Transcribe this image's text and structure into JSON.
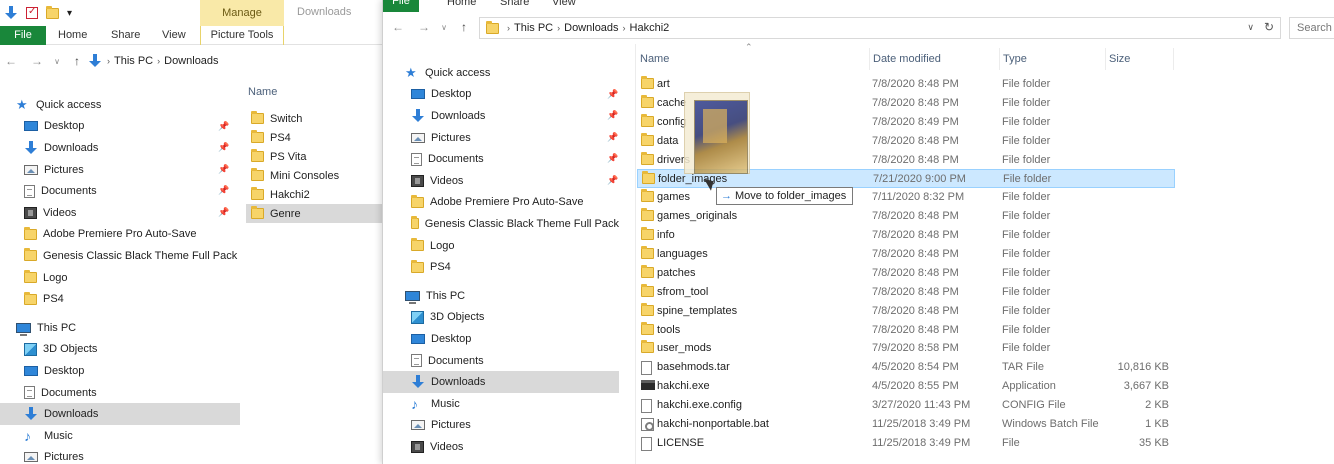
{
  "background_window": {
    "ribbon": {
      "manage_tab": "Manage",
      "title": "Downloads",
      "file_tab": "File",
      "tabs": [
        "Home",
        "Share",
        "View"
      ],
      "picture_tools": "Picture Tools"
    },
    "address": {
      "crumbs": [
        "This PC",
        "Downloads"
      ]
    },
    "nav": {
      "quick_access": "Quick access",
      "pinned": [
        {
          "label": "Desktop",
          "icon": "desktop-icon"
        },
        {
          "label": "Downloads",
          "icon": "downloads-icon"
        },
        {
          "label": "Pictures",
          "icon": "pictures-icon"
        },
        {
          "label": "Documents",
          "icon": "documents-icon"
        },
        {
          "label": "Videos",
          "icon": "videos-icon"
        }
      ],
      "recent": [
        "Adobe Premiere Pro Auto-Save",
        "Genesis Classic Black Theme Full Pack",
        "Logo",
        "PS4"
      ],
      "this_pc": "This PC",
      "pc_items": [
        "3D Objects",
        "Desktop",
        "Documents",
        "Downloads",
        "Music",
        "Pictures"
      ]
    },
    "list": {
      "header": "Name",
      "items": [
        "Switch",
        "PS4",
        "PS Vita",
        "Mini Consoles",
        "Hakchi2",
        "Genre"
      ],
      "selected_index": 5
    }
  },
  "foreground_window": {
    "ribbon": {
      "file_tab": "File",
      "tabs": [
        "Home",
        "Share",
        "View"
      ]
    },
    "address": {
      "crumbs": [
        "This PC",
        "Downloads",
        "Hakchi2"
      ]
    },
    "search_placeholder": "Search",
    "nav": {
      "quick_access": "Quick access",
      "pinned": [
        "Desktop",
        "Downloads",
        "Pictures",
        "Documents",
        "Videos"
      ],
      "recent": [
        "Adobe Premiere Pro Auto-Save",
        "Genesis Classic Black Theme Full Pack",
        "Logo",
        "PS4"
      ],
      "this_pc": "This PC",
      "pc_items": [
        "3D Objects",
        "Desktop",
        "Documents",
        "Downloads",
        "Music",
        "Pictures",
        "Videos"
      ]
    },
    "columns": {
      "name": "Name",
      "date": "Date modified",
      "type": "Type",
      "size": "Size"
    },
    "files": [
      {
        "name": "art",
        "date": "7/8/2020 8:48 PM",
        "type": "File folder",
        "size": "",
        "icon": "folder-icon"
      },
      {
        "name": "cache",
        "date": "7/8/2020 8:48 PM",
        "type": "File folder",
        "size": "",
        "icon": "folder-icon"
      },
      {
        "name": "config",
        "date": "7/8/2020 8:49 PM",
        "type": "File folder",
        "size": "",
        "icon": "folder-icon"
      },
      {
        "name": "data",
        "date": "7/8/2020 8:48 PM",
        "type": "File folder",
        "size": "",
        "icon": "folder-icon"
      },
      {
        "name": "drivers",
        "date": "7/8/2020 8:48 PM",
        "type": "File folder",
        "size": "",
        "icon": "folder-icon"
      },
      {
        "name": "folder_images",
        "date": "7/21/2020 9:00 PM",
        "type": "File folder",
        "size": "",
        "icon": "folder-icon"
      },
      {
        "name": "games",
        "date": "7/11/2020 8:32 PM",
        "type": "File folder",
        "size": "",
        "icon": "folder-icon"
      },
      {
        "name": "games_originals",
        "date": "7/8/2020 8:48 PM",
        "type": "File folder",
        "size": "",
        "icon": "folder-icon"
      },
      {
        "name": "info",
        "date": "7/8/2020 8:48 PM",
        "type": "File folder",
        "size": "",
        "icon": "folder-icon"
      },
      {
        "name": "languages",
        "date": "7/8/2020 8:48 PM",
        "type": "File folder",
        "size": "",
        "icon": "folder-icon"
      },
      {
        "name": "patches",
        "date": "7/8/2020 8:48 PM",
        "type": "File folder",
        "size": "",
        "icon": "folder-icon"
      },
      {
        "name": "sfrom_tool",
        "date": "7/8/2020 8:48 PM",
        "type": "File folder",
        "size": "",
        "icon": "folder-icon"
      },
      {
        "name": "spine_templates",
        "date": "7/8/2020 8:48 PM",
        "type": "File folder",
        "size": "",
        "icon": "folder-icon"
      },
      {
        "name": "tools",
        "date": "7/8/2020 8:48 PM",
        "type": "File folder",
        "size": "",
        "icon": "folder-icon"
      },
      {
        "name": "user_mods",
        "date": "7/9/2020 8:58 PM",
        "type": "File folder",
        "size": "",
        "icon": "folder-icon"
      },
      {
        "name": "basehmods.tar",
        "date": "4/5/2020 8:54 PM",
        "type": "TAR File",
        "size": "10,816 KB",
        "icon": "file-icon"
      },
      {
        "name": "hakchi.exe",
        "date": "4/5/2020 8:55 PM",
        "type": "Application",
        "size": "3,667 KB",
        "icon": "exe-icon"
      },
      {
        "name": "hakchi.exe.config",
        "date": "3/27/2020 11:43 PM",
        "type": "CONFIG File",
        "size": "2 KB",
        "icon": "config-file-icon"
      },
      {
        "name": "hakchi-nonportable.bat",
        "date": "11/25/2018 3:49 PM",
        "type": "Windows Batch File",
        "size": "1 KB",
        "icon": "batch-file-icon"
      },
      {
        "name": "LICENSE",
        "date": "11/25/2018 3:49 PM",
        "type": "File",
        "size": "35 KB",
        "icon": "file-icon"
      }
    ],
    "selected_index": 5,
    "drag_tooltip": "Move to folder_images"
  },
  "colors": {
    "file_tab": "#19873a",
    "manage_tab": "#f9e9a8",
    "selection": "#cce8ff",
    "nav_selected": "#d9d9d9",
    "header_text": "#4c607a"
  }
}
